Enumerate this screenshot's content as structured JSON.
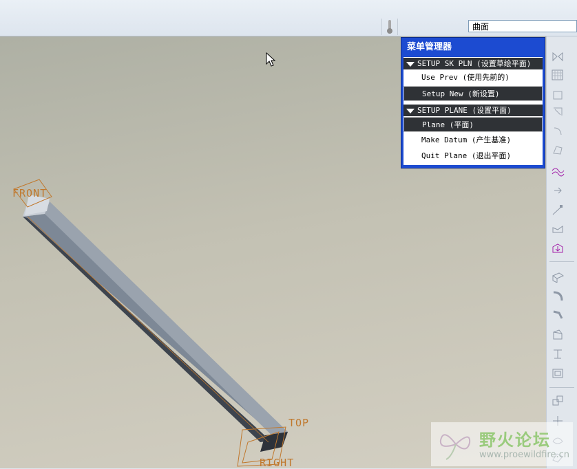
{
  "toolbar": {
    "filter_value": "曲面"
  },
  "viewport": {
    "datum_labels": {
      "front": "FRONT",
      "top": "TOP",
      "right": "RIGHT"
    }
  },
  "menu_manager": {
    "title": "菜单管理器",
    "sections": [
      {
        "header": "SETUP SK PLN (设置草绘平面)",
        "items": [
          {
            "label": "Use Prev (使用先前的)",
            "selected": false
          },
          {
            "label": "Setup New (新设置)",
            "selected": true
          }
        ]
      },
      {
        "header": "SETUP PLANE (设置平面)",
        "items": [
          {
            "label": "Plane (平面)",
            "selected": true
          },
          {
            "label": "Make Datum (产生基准)",
            "selected": false
          },
          {
            "label": "Quit Plane (退出平面)",
            "selected": false
          }
        ]
      }
    ]
  },
  "watermark": {
    "title": "野火论坛",
    "url": "www.proewildfire.cn"
  },
  "icons": [
    "thermometer-icon",
    "mirror-icon",
    "grid-icon",
    "rectangle-icon",
    "corner-icon",
    "arc-icon",
    "shape-icon",
    "curve-icon",
    "arrow-icon",
    "line-icon",
    "flange-icon",
    "extrude-icon",
    "plane-icon",
    "round-icon",
    "chamfer-icon",
    "rib-icon",
    "draft-icon",
    "shell-icon",
    "pattern-icon",
    "datum-icon",
    "surface-icon"
  ],
  "colors": {
    "menu_title_bg": "#1c4bd1",
    "menu_selected_bg": "#2f3236",
    "datum_color": "#c0782d"
  }
}
